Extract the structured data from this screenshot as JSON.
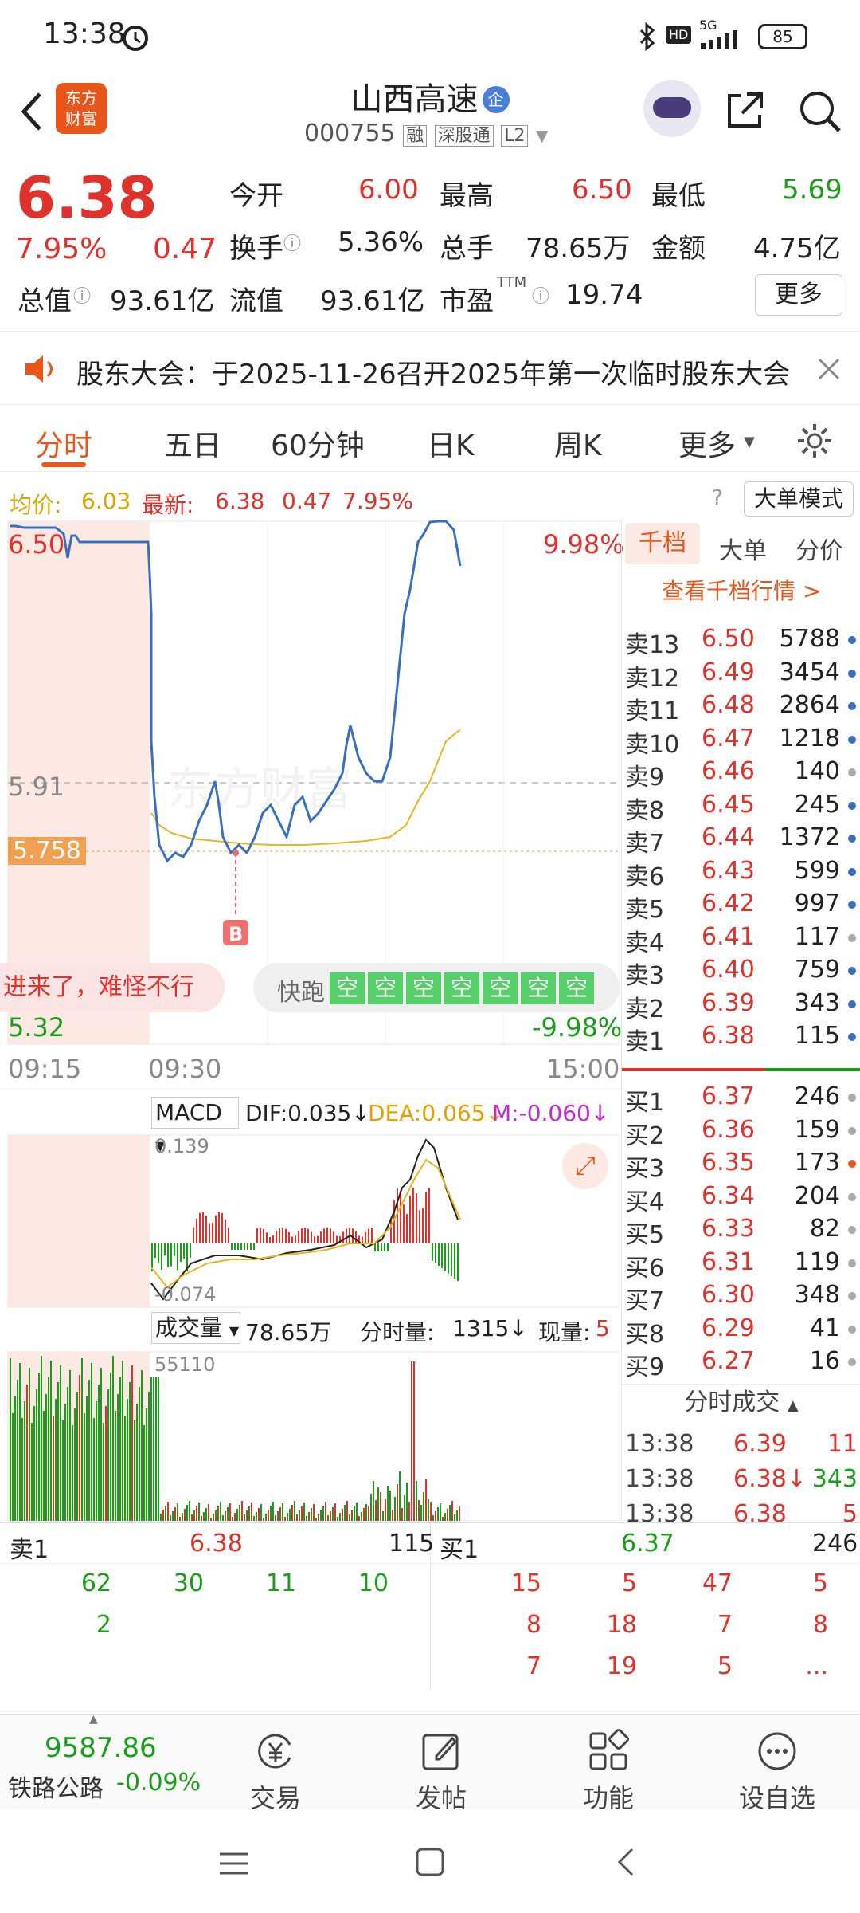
{
  "status": {
    "time": "13:38",
    "battery": "85",
    "net": "5G"
  },
  "header": {
    "logo": "东方\n财富",
    "title": "山西高速",
    "badge": "企",
    "code": "000755",
    "tags": [
      "融",
      "深股通",
      "L2"
    ]
  },
  "quote": {
    "price": "6.38",
    "pct": "7.95%",
    "chg": "0.47",
    "row1": [
      {
        "k": "今开",
        "v": "6.00",
        "c": "red"
      },
      {
        "k": "最高",
        "v": "6.50",
        "c": "red"
      },
      {
        "k": "最低",
        "v": "5.69",
        "c": "grn"
      }
    ],
    "row2": [
      {
        "k": "换手",
        "v": "5.36%",
        "c": "dark"
      },
      {
        "k": "总手",
        "v": "78.65万",
        "c": "dark"
      },
      {
        "k": "金额",
        "v": "4.75亿",
        "c": "dark"
      }
    ],
    "row3": [
      {
        "k": "总值",
        "v": "93.61亿"
      },
      {
        "k": "流值",
        "v": "93.61亿"
      },
      {
        "k": "市盈",
        "sup": "TTM",
        "v": "19.74"
      }
    ],
    "more": "更多"
  },
  "notice": {
    "text": "股东大会：于2025-11-26召开2025年第一次临时股东大会"
  },
  "tabs": [
    "分时",
    "五日",
    "60分钟",
    "日K",
    "周K",
    "更多"
  ],
  "avgbar": {
    "avg_label": "均价:",
    "avg": "6.03",
    "last_label": "最新:",
    "last": "6.38",
    "chg": "0.47",
    "pct": "7.95%",
    "mode": "大单模式"
  },
  "chart": {
    "high": "6.50",
    "mid": "5.91",
    "buy_line": "5.758",
    "low": "5.32",
    "pct_up": "9.98%",
    "pct_dn": "-9.98%",
    "t0": "09:15",
    "t1": "09:30",
    "t2": "15:00",
    "marker": "B",
    "watermark": "东方财富",
    "banner": "进来了，难怪不行",
    "fast_label": "快跑",
    "fast_cells": [
      "空",
      "空",
      "空",
      "空",
      "空",
      "空",
      "空"
    ]
  },
  "macd": {
    "name": "MACD",
    "dif": "DIF:0.035↓",
    "dea": "DEA:0.065↓",
    "m": "M:-0.060↓",
    "top": "0.139",
    "bot": "-0.074"
  },
  "vol": {
    "name": "成交量",
    "total": "78.65万",
    "period_label": "分时量:",
    "period": "1315↓",
    "now_label": "现量:",
    "now": "5",
    "max": "55110"
  },
  "book": {
    "tabs": [
      "千档",
      "大单",
      "分价"
    ],
    "link": "查看千档行情 >",
    "asks": [
      {
        "l": "卖13",
        "p": "6.50",
        "v": "5788",
        "d": "b"
      },
      {
        "l": "卖12",
        "p": "6.49",
        "v": "3454",
        "d": "b"
      },
      {
        "l": "卖11",
        "p": "6.48",
        "v": "2864",
        "d": "b"
      },
      {
        "l": "卖10",
        "p": "6.47",
        "v": "1218",
        "d": "b"
      },
      {
        "l": "卖9",
        "p": "6.46",
        "v": "140",
        "d": "g"
      },
      {
        "l": "卖8",
        "p": "6.45",
        "v": "245",
        "d": "b"
      },
      {
        "l": "卖7",
        "p": "6.44",
        "v": "1372",
        "d": "b"
      },
      {
        "l": "卖6",
        "p": "6.43",
        "v": "599",
        "d": "b"
      },
      {
        "l": "卖5",
        "p": "6.42",
        "v": "997",
        "d": "b"
      },
      {
        "l": "卖4",
        "p": "6.41",
        "v": "117",
        "d": "g"
      },
      {
        "l": "卖3",
        "p": "6.40",
        "v": "759",
        "d": "b"
      },
      {
        "l": "卖2",
        "p": "6.39",
        "v": "343",
        "d": "b"
      },
      {
        "l": "卖1",
        "p": "6.38",
        "v": "115",
        "d": "b"
      }
    ],
    "bids": [
      {
        "l": "买1",
        "p": "6.37",
        "v": "246",
        "d": "g"
      },
      {
        "l": "买2",
        "p": "6.36",
        "v": "159",
        "d": "g"
      },
      {
        "l": "买3",
        "p": "6.35",
        "v": "173",
        "d": "o"
      },
      {
        "l": "买4",
        "p": "6.34",
        "v": "204",
        "d": "g"
      },
      {
        "l": "买5",
        "p": "6.33",
        "v": "82",
        "d": "g"
      },
      {
        "l": "买6",
        "p": "6.31",
        "v": "119",
        "d": "g"
      },
      {
        "l": "买7",
        "p": "6.30",
        "v": "348",
        "d": "g"
      },
      {
        "l": "买8",
        "p": "6.29",
        "v": "41",
        "d": "g"
      },
      {
        "l": "买9",
        "p": "6.27",
        "v": "16",
        "d": "g"
      }
    ],
    "trades_title": "分时成交",
    "trades": [
      {
        "t": "13:38",
        "p": "6.39",
        "v": "11",
        "c": "red"
      },
      {
        "t": "13:38",
        "p": "6.38↓",
        "v": "343",
        "c": "grn"
      },
      {
        "t": "13:38",
        "p": "6.38",
        "v": "5",
        "c": "red"
      }
    ]
  },
  "bottomq": {
    "sell_label": "卖1",
    "sell_p": "6.38",
    "sell_v": "115",
    "buy_label": "买1",
    "buy_p": "6.37",
    "buy_v": "246",
    "sell_rows": [
      [
        "62",
        "30",
        "11",
        "10"
      ],
      [
        "2",
        "",
        "",
        ""
      ]
    ],
    "buy_rows": [
      [
        "15",
        "5",
        "47",
        "5"
      ],
      [
        "8",
        "18",
        "7",
        "8"
      ],
      [
        "7",
        "19",
        "5",
        "..."
      ]
    ]
  },
  "nav": {
    "index": "9587.86",
    "index_name": "铁路公路",
    "index_pct": "-0.09%",
    "items": [
      "交易",
      "发帖",
      "功能",
      "设自选"
    ]
  }
}
